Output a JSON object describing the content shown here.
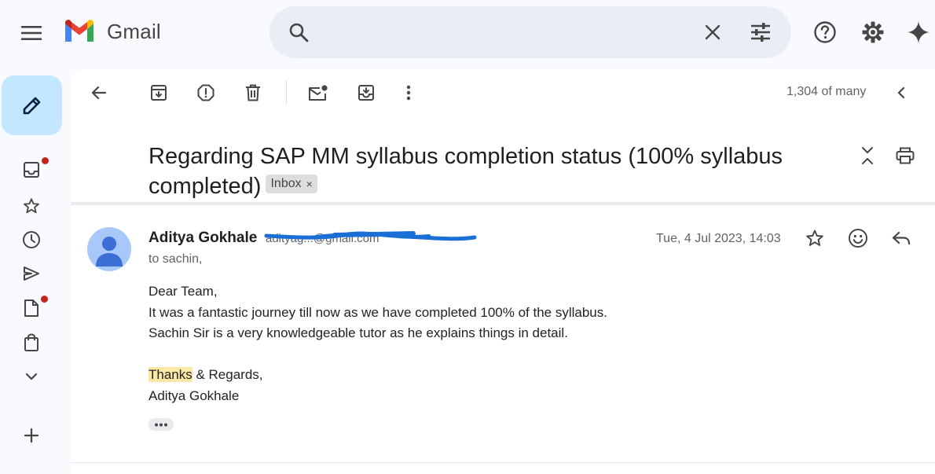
{
  "app": {
    "name": "Gmail"
  },
  "search": {
    "value": "",
    "placeholder": ""
  },
  "toolbar": {
    "counter": "1,304 of many"
  },
  "email": {
    "subject": "Regarding SAP MM syllabus completion status (100% syllabus completed)",
    "label_chip": "Inbox",
    "sender_name": "Aditya Gokhale",
    "sender_email": "adityag...@gmail.com",
    "recipient": "to sachin,",
    "date": "Tue, 4 Jul 2023, 14:03",
    "body": {
      "greeting": "Dear Team,",
      "line1": "It was a fantastic journey till now as we have completed 100% of the syllabus.",
      "line2": "Sachin Sir is a very knowledgeable tutor as he explains things in detail.",
      "signoff_highlight": "Thanks",
      "signoff_rest": " & Regards,",
      "signature": "Aditya Gokhale"
    }
  },
  "sidebar": {
    "items": [
      {
        "icon": "inbox-icon",
        "has_badge": true
      },
      {
        "icon": "star-icon",
        "has_badge": false
      },
      {
        "icon": "clock-icon",
        "has_badge": false
      },
      {
        "icon": "send-icon",
        "has_badge": false
      },
      {
        "icon": "draft-icon",
        "has_badge": true
      },
      {
        "icon": "bag-icon",
        "has_badge": false
      },
      {
        "icon": "chevron-down-icon",
        "has_badge": false
      }
    ]
  },
  "colors": {
    "accent": "#c2e7ff",
    "badge": "#c5221f",
    "search_bg": "#e9eef6",
    "highlight": "#fce8a5",
    "redaction": "#1a6fd6"
  }
}
